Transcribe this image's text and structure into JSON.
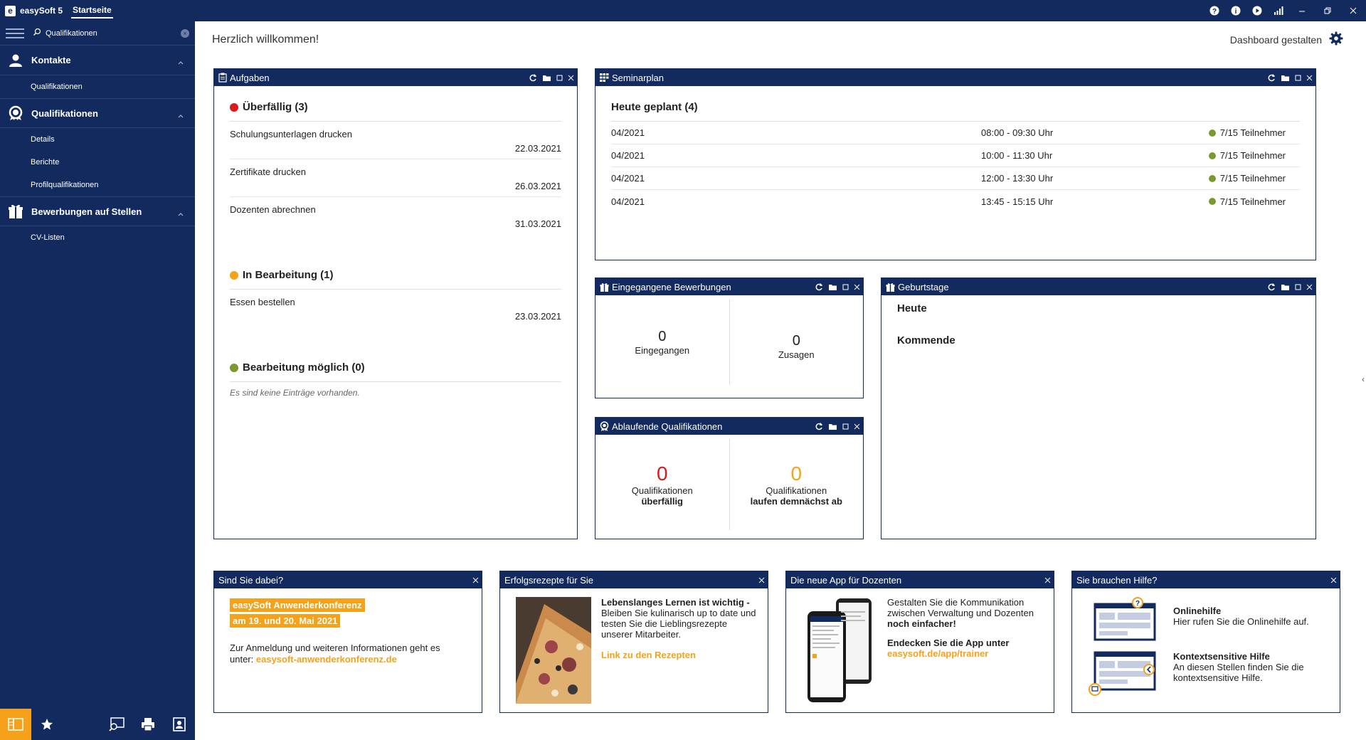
{
  "app": {
    "logo_letter": "e",
    "name": "easySoft 5",
    "tab": "Startseite"
  },
  "topbar_icons": [
    "help-icon",
    "info-icon",
    "play-icon",
    "signal-icon",
    "minimize-icon",
    "restore-icon",
    "close-icon"
  ],
  "sidebar": {
    "search_value": "Qualifikationen",
    "sections": [
      {
        "label": "Kontakte",
        "icon": "person-icon",
        "items": [
          "Qualifikationen"
        ]
      },
      {
        "label": "Qualifikationen",
        "icon": "badge-icon",
        "items": [
          "Details",
          "Berichte",
          "Profilqualifikationen"
        ]
      },
      {
        "label": "Bewerbungen auf Stellen",
        "icon": "gift-icon",
        "items": [
          "CV-Listen"
        ]
      }
    ]
  },
  "header": {
    "welcome": "Herzlich willkommen!",
    "dashboard_config": "Dashboard gestalten"
  },
  "aufgaben": {
    "title": "Aufgaben",
    "groups": [
      {
        "title": "Überfällig (3)",
        "color": "#d91b1b",
        "tasks": [
          {
            "name": "Schulungsunterlagen drucken",
            "date": "22.03.2021"
          },
          {
            "name": "Zertifikate drucken",
            "date": "26.03.2021"
          },
          {
            "name": "Dozenten abrechnen",
            "date": "31.03.2021"
          }
        ]
      },
      {
        "title": "In Bearbeitung (1)",
        "color": "#f5a11a",
        "tasks": [
          {
            "name": "Essen bestellen",
            "date": "23.03.2021"
          }
        ]
      },
      {
        "title": "Bearbeitung möglich (0)",
        "color": "#7a9a2e",
        "empty": "Es sind keine Einträge vorhanden."
      }
    ]
  },
  "seminarplan": {
    "title": "Seminarplan",
    "heading": "Heute geplant (4)",
    "rows": [
      {
        "name": "04/2021",
        "time": "08:00 - 09:30 Uhr",
        "participants": "7/15 Teilnehmer"
      },
      {
        "name": "04/2021",
        "time": "10:00 - 11:30 Uhr",
        "participants": "7/15 Teilnehmer"
      },
      {
        "name": "04/2021",
        "time": "12:00 - 13:30 Uhr",
        "participants": "7/15 Teilnehmer"
      },
      {
        "name": "04/2021",
        "time": "13:45 - 15:15 Uhr",
        "participants": "7/15 Teilnehmer"
      }
    ]
  },
  "bewerbungen": {
    "title": "Eingegangene Bewerbungen",
    "left_value": "0",
    "left_label": "Eingegangen",
    "right_value": "0",
    "right_label": "Zusagen"
  },
  "ablaufende": {
    "title": "Ablaufende Qualifikationen",
    "left_value": "0",
    "left_label1": "Qualifikationen",
    "left_label2": "überfällig",
    "right_value": "0",
    "right_label1": "Qualifikationen",
    "right_label2": "laufen demnächst ab",
    "left_color": "#d91b1b",
    "right_color": "#f5a11a"
  },
  "geburtstage": {
    "title": "Geburtstage",
    "today": "Heute",
    "upcoming": "Kommende"
  },
  "promo1": {
    "title": "Sind Sie dabei?",
    "highlight1": "easySoft Anwenderkonferenz",
    "highlight2": "am 19. und 20. Mai 2021",
    "text": "Zur Anmeldung und weiteren Informationen geht es unter:",
    "link": "easysoft-anwenderkonferenz.de"
  },
  "promo2": {
    "title": "Erfolgsrezepte für Sie",
    "bold": "Lebenslanges Lernen ist wichtig -",
    "text": " Bleiben Sie kulinarisch up to date und testen Sie die Lieblingsrezepte unserer Mitarbeiter.",
    "link": "Link zu den Rezepten"
  },
  "promo3": {
    "title": "Die neue App für Dozenten",
    "text1": "Gestalten Sie die Kommunikation zwischen Verwaltung und Dozenten ",
    "bold1": "noch einfacher!",
    "bold2": "Endecken Sie die App unter",
    "link": "easysoft.de/app/trainer"
  },
  "promo4": {
    "title": "Sie brauchen Hilfe?",
    "h1": "Onlinehilfe",
    "t1": "Hier rufen Sie die Onlinehilfe auf.",
    "h2": "Kontextsensitive Hilfe",
    "t2": "An diesen Stellen finden Sie die kontextsensitive Hilfe."
  },
  "colors": {
    "navy": "#132a5e",
    "orange": "#f5a11a",
    "red": "#d91b1b",
    "green": "#7a9a2e"
  }
}
